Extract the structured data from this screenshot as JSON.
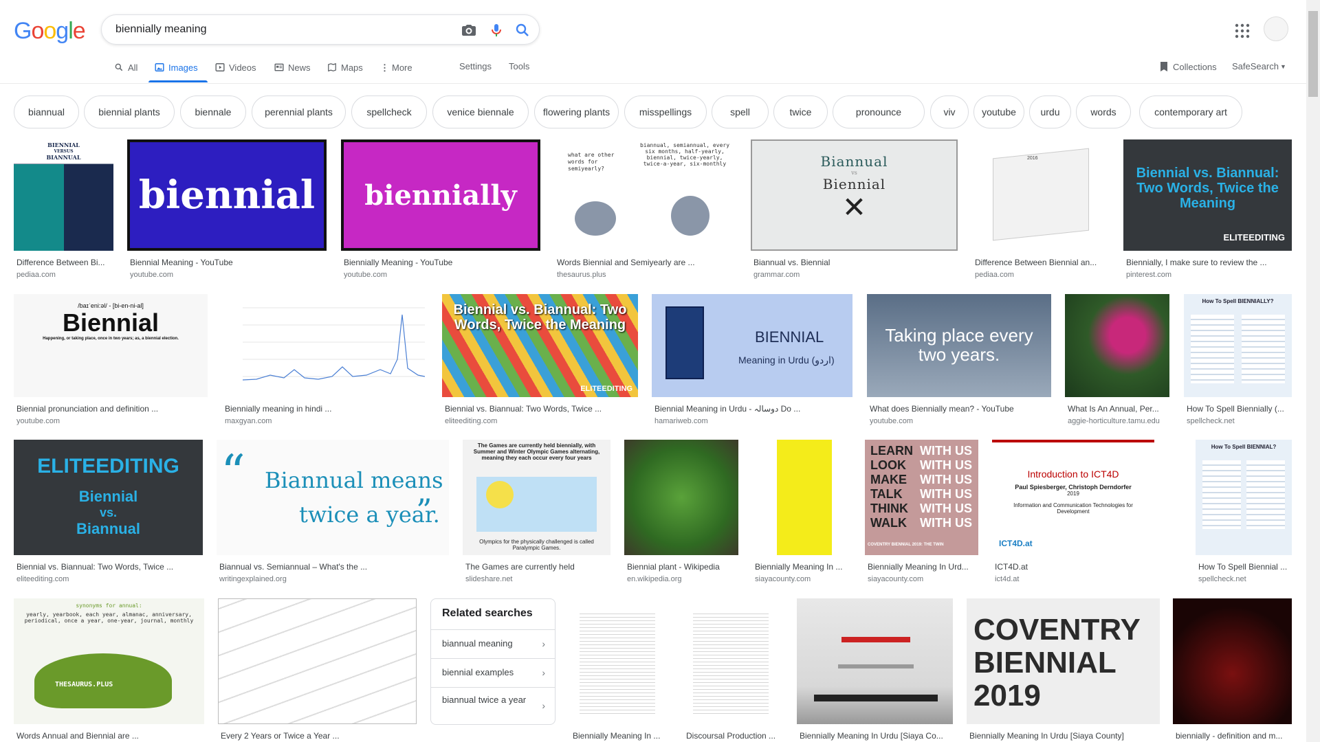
{
  "search": {
    "query": "biennially meaning"
  },
  "logo": {
    "letters": [
      "G",
      "o",
      "o",
      "g",
      "l",
      "e"
    ],
    "colors": [
      "#4285F4",
      "#EA4335",
      "#FBBC05",
      "#4285F4",
      "#34A853",
      "#EA4335"
    ]
  },
  "tabs": [
    {
      "label": "All",
      "icon": "search-icon"
    },
    {
      "label": "Images",
      "icon": "image-icon"
    },
    {
      "label": "Videos",
      "icon": "play-icon"
    },
    {
      "label": "News",
      "icon": "news-icon"
    },
    {
      "label": "Maps",
      "icon": "map-icon"
    },
    {
      "label": "More",
      "icon": "more-vert-icon"
    }
  ],
  "tools": {
    "settings": "Settings",
    "tools": "Tools",
    "collections": "Collections",
    "safesearch": "SafeSearch"
  },
  "chips": [
    "biannual",
    "biennial plants",
    "biennale",
    "perennial plants",
    "spellcheck",
    "venice biennale",
    "flowering plants",
    "misspellings",
    "spell",
    "twice",
    "pronounce",
    "viv",
    "youtube",
    "urdu",
    "words",
    "contemporary art"
  ],
  "results": [
    {
      "caption": "Difference Between Bi...",
      "source": "pediaa.com",
      "text": [
        "BIENNIAL",
        "VERSUS",
        "BIANNUAL"
      ]
    },
    {
      "caption": "Biennial Meaning - YouTube",
      "source": "youtube.com",
      "text": [
        "biennial"
      ]
    },
    {
      "caption": "Biennially Meaning - YouTube",
      "source": "youtube.com",
      "text": [
        "biennially"
      ]
    },
    {
      "caption": "Words Biennial and Semiyearly are ...",
      "source": "thesaurus.plus",
      "text": [
        "what are other words for semiyearly?",
        "biannual, semiannual, every six months, half-yearly, biennial, twice-yearly, twice-a-year, six-monthly"
      ]
    },
    {
      "caption": "Biannual vs. Biennial",
      "source": "grammar.com",
      "text": [
        "Biannual",
        "vs",
        "Biennial"
      ]
    },
    {
      "caption": "Difference Between Biennial an...",
      "source": "pediaa.com",
      "text": [
        "2016"
      ]
    },
    {
      "caption": "Biennially, I make sure to review the ...",
      "source": "pinterest.com",
      "text": [
        "Biennial vs. Biannual: Two Words, Twice the Meaning",
        "ELITEEDITING"
      ]
    },
    {
      "caption": "Biennial pronunciation and definition ...",
      "source": "youtube.com",
      "text": [
        "/baɪˈeni:əl/ - [bi-en-ni-al]",
        "Biennial",
        "Happening, or taking place, once in two years; as, a biennial election."
      ]
    },
    {
      "caption": "Biennially meaning in hindi ...",
      "source": "maxgyan.com",
      "text": []
    },
    {
      "caption": "Biennial vs. Biannual: Two Words, Twice ...",
      "source": "eliteediting.com",
      "text": [
        "Biennial vs. Biannual: Two Words, Twice the Meaning",
        "ELITEEDITING"
      ]
    },
    {
      "caption": "Biennial Meaning in Urdu - دوسالہ Do ...",
      "source": "hamariweb.com",
      "text": [
        "BIENNIAL",
        "Meaning in Urdu (اردو)"
      ]
    },
    {
      "caption": "What does Biennially mean? - YouTube",
      "source": "youtube.com",
      "text": [
        "Taking place every two years."
      ]
    },
    {
      "caption": "What Is An Annual, Per...",
      "source": "aggie-horticulture.tamu.edu",
      "text": []
    },
    {
      "caption": "How To Spell Biennially (...",
      "source": "spellcheck.net",
      "text": [
        "How To Spell BIENNIALLY?"
      ]
    },
    {
      "caption": "Biennial vs. Biannual: Two Words, Twice ...",
      "source": "eliteediting.com",
      "text": [
        "ELITEEDITING",
        "Biennial",
        "vs.",
        "Biannual"
      ]
    },
    {
      "caption": "Biannual vs. Semiannual – What's the ...",
      "source": "writingexplained.org",
      "text": [
        "Biannual means",
        "twice a year."
      ]
    },
    {
      "caption": "The Games are currently held",
      "source": "slideshare.net",
      "text": [
        "The Games are currently held biennially, with Summer and Winter Olympic Games alternating, meaning they each occur every four years",
        "Olympics for the physically challenged is called Paralympic Games."
      ]
    },
    {
      "caption": "Biennial plant - Wikipedia",
      "source": "en.wikipedia.org",
      "text": []
    },
    {
      "caption": "Biennially Meaning In ...",
      "source": "siayacounty.com",
      "text": []
    },
    {
      "caption": "Biennially Meaning In Urd...",
      "source": "siayacounty.com",
      "text": [
        "LEARN",
        "LOOK",
        "MAKE",
        "TALK",
        "THINK",
        "WALK",
        "WITH US",
        "COVENTRY BIENNIAL 2019: THE TWIN"
      ]
    },
    {
      "caption": "ICT4D.at",
      "source": "ict4d.at",
      "text": [
        "Introduction to ICT4D",
        "Paul Spiesberger, Christoph Derndorfer",
        "2019",
        "Information and Communication Technologies for Development",
        "ICT4D.at"
      ]
    },
    {
      "caption": "How To Spell Biennial ...",
      "source": "spellcheck.net",
      "text": [
        "How To Spell BIENNIAL?"
      ]
    },
    {
      "caption": "Words Annual and Biennial are ...",
      "source": "",
      "text": [
        "synonyms for annual:",
        "yearly, yearbook, each year, almanac, anniversary, periodical, once a year, one-year, journal, monthly",
        "THESAURUS.PLUS"
      ]
    },
    {
      "caption": "Every 2 Years or Twice a Year ...",
      "source": "",
      "text": []
    },
    {
      "caption": "Biennially Meaning In ...",
      "source": "",
      "text": []
    },
    {
      "caption": "Discoursal Production ...",
      "source": "",
      "text": []
    },
    {
      "caption": "Biennially Meaning In Urdu [Siaya Co...",
      "source": "",
      "text": []
    },
    {
      "caption": "Biennially Meaning In Urdu [Siaya County]",
      "source": "",
      "text": [
        "COVENTRY",
        "BIENNIAL",
        "2019"
      ]
    },
    {
      "caption": "biennially - definition and m...",
      "source": "",
      "text": []
    }
  ],
  "related": {
    "title": "Related searches",
    "items": [
      "biannual meaning",
      "biennial examples",
      "biannual twice a year"
    ]
  }
}
